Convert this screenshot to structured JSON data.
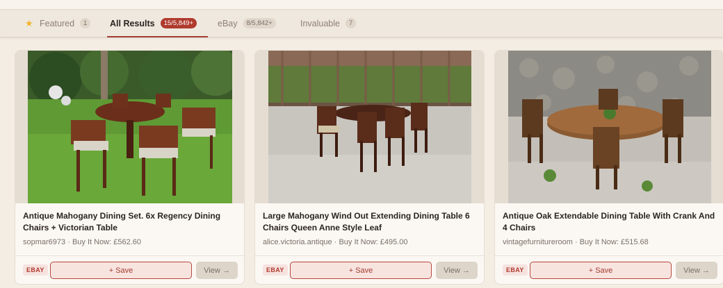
{
  "tabs": [
    {
      "label": "Featured",
      "count": "1",
      "icon": "star-icon",
      "active": false
    },
    {
      "label": "All Results",
      "count": "15/5,849+",
      "active": true
    },
    {
      "label": "eBay",
      "count": "8/5,842+",
      "active": false
    },
    {
      "label": "Invaluable",
      "count": "7",
      "active": false
    }
  ],
  "results": [
    {
      "title": "Antique Mahogany Dining Set. 6x Regency Dining Chairs + Victorian Table",
      "seller": "sopmar6973",
      "sep": "·",
      "price": "Buy It Now: £562.60",
      "source": "EBAY",
      "save_label": "+ Save",
      "view_label": "View →"
    },
    {
      "title": "Large Mahogany Wind Out Extending Dining Table 6 Chairs Queen Anne Style Leaf",
      "seller": "alice.victoria.antique",
      "sep": "·",
      "price": "Buy It Now: £495.00",
      "source": "EBAY",
      "save_label": "+ Save",
      "view_label": "View →"
    },
    {
      "title": "Antique Oak Extendable Dining Table With Crank And 4 Chairs",
      "seller": "vintagefurnitureroom",
      "sep": "·",
      "price": "Buy It Now: £515.68",
      "source": "EBAY",
      "save_label": "+ Save",
      "view_label": "View →"
    }
  ],
  "colors": {
    "accent": "#b03a2e",
    "background": "#f3ede4",
    "card": "#fbf8f4"
  }
}
